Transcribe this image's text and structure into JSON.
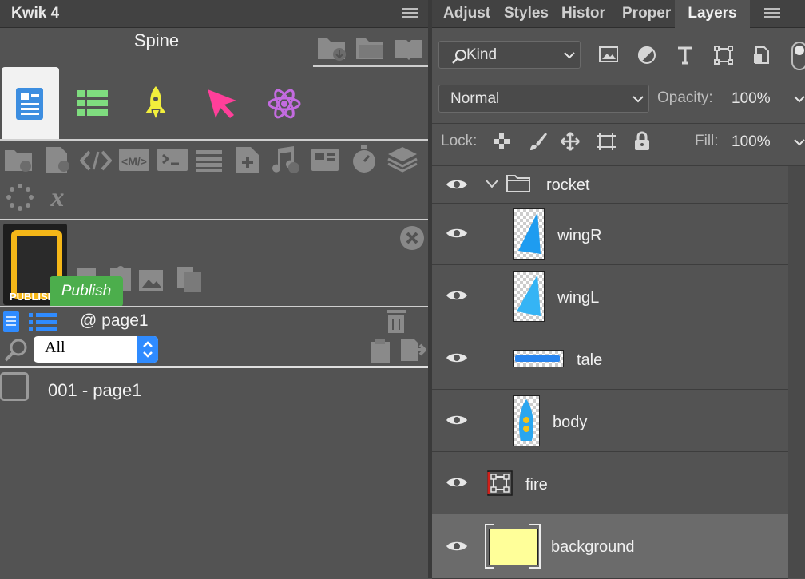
{
  "left_panel": {
    "tab_title": "Kwik 4",
    "spine_label": "Spine",
    "publish_icon_label": "PUBLISH",
    "publish_tooltip": "Publish",
    "page_label": "@ page1",
    "filter_select": {
      "value": "All"
    },
    "pages": [
      {
        "label": "001 - page1"
      }
    ]
  },
  "right_panel": {
    "tabs": [
      "Adjust",
      "Styles",
      "Histor",
      "Proper",
      "Layers"
    ],
    "active_tab": "Layers",
    "kind_filter": "Kind",
    "blend_mode": "Normal",
    "opacity_label": "Opacity:",
    "opacity_value": "100%",
    "lock_label": "Lock:",
    "fill_label": "Fill:",
    "fill_value": "100%",
    "layers": [
      {
        "name": "rocket",
        "type": "group",
        "expanded": true
      },
      {
        "name": "wingR",
        "type": "image"
      },
      {
        "name": "wingL",
        "type": "image"
      },
      {
        "name": "tale",
        "type": "image"
      },
      {
        "name": "body",
        "type": "image"
      },
      {
        "name": "fire",
        "type": "transform"
      },
      {
        "name": "background",
        "type": "solid",
        "color": "#ffff99",
        "selected": true
      }
    ]
  },
  "colors": {
    "panel_bg": "#535353",
    "tab_bg": "#424242",
    "publish_green": "#4cae4c",
    "accent_blue": "#2f8bff",
    "selected_row": "#6b6b6b"
  }
}
